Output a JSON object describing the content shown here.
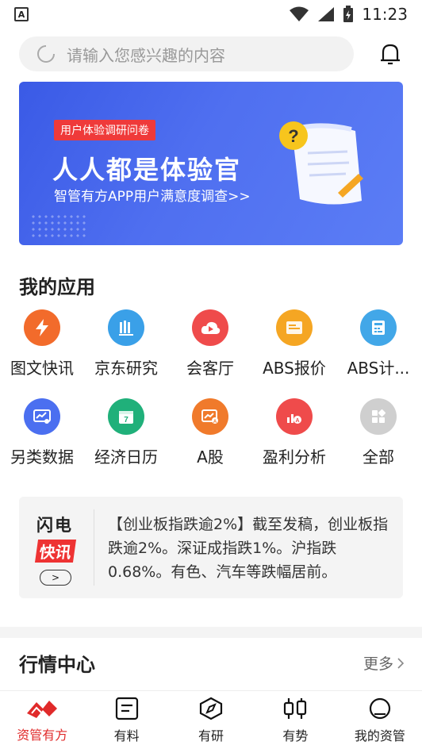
{
  "status_bar": {
    "time": "11:23",
    "left_badge": "A"
  },
  "search": {
    "placeholder": "请输入您感兴趣的内容"
  },
  "banner": {
    "tag": "用户体验调研问卷",
    "title": "人人都是体验官",
    "subtitle": "智管有方APP用户满意度调查>>"
  },
  "my_apps": {
    "title": "我的应用",
    "items": [
      {
        "label": "图文快讯",
        "icon": "lightning-icon",
        "color": "#f26b2b"
      },
      {
        "label": "京东研究",
        "icon": "research-icon",
        "color": "#3aa0e8"
      },
      {
        "label": "会客厅",
        "icon": "cloud-play-icon",
        "color": "#ef4b4b"
      },
      {
        "label": "ABS报价",
        "icon": "abs-quote-icon",
        "color": "#f5a623"
      },
      {
        "label": "ABS计...",
        "icon": "calculator-icon",
        "color": "#42a7e8"
      },
      {
        "label": "另类数据",
        "icon": "data-screen-icon",
        "color": "#4b6ff0"
      },
      {
        "label": "经济日历",
        "icon": "calendar-icon",
        "color": "#20b07a"
      },
      {
        "label": "A股",
        "icon": "a-share-icon",
        "color": "#f07a2b"
      },
      {
        "label": "盈利分析",
        "icon": "profit-analysis-icon",
        "color": "#ef4b4b"
      },
      {
        "label": "全部",
        "icon": "all-apps-icon",
        "color": "#cfcfcf"
      }
    ]
  },
  "flash": {
    "logo_line1": "闪电",
    "logo_line2": "快讯",
    "text": "【创业板指跌逾2%】截至发稿，创业板指跌逾2%。深证成指跌1%。沪指跌0.68%。有色、汽车等跌幅居前。"
  },
  "market": {
    "title": "行情中心",
    "more": "更多"
  },
  "bottom_nav": [
    {
      "label": "资管有方",
      "icon": "home-logo-icon",
      "active": true
    },
    {
      "label": "有料",
      "icon": "document-icon",
      "active": false
    },
    {
      "label": "有研",
      "icon": "compass-icon",
      "active": false
    },
    {
      "label": "有势",
      "icon": "candlestick-icon",
      "active": false
    },
    {
      "label": "我的资管",
      "icon": "profile-icon",
      "active": false
    }
  ],
  "colors": {
    "accent": "#e02a2a",
    "banner_blue": "#4f6ff0"
  }
}
